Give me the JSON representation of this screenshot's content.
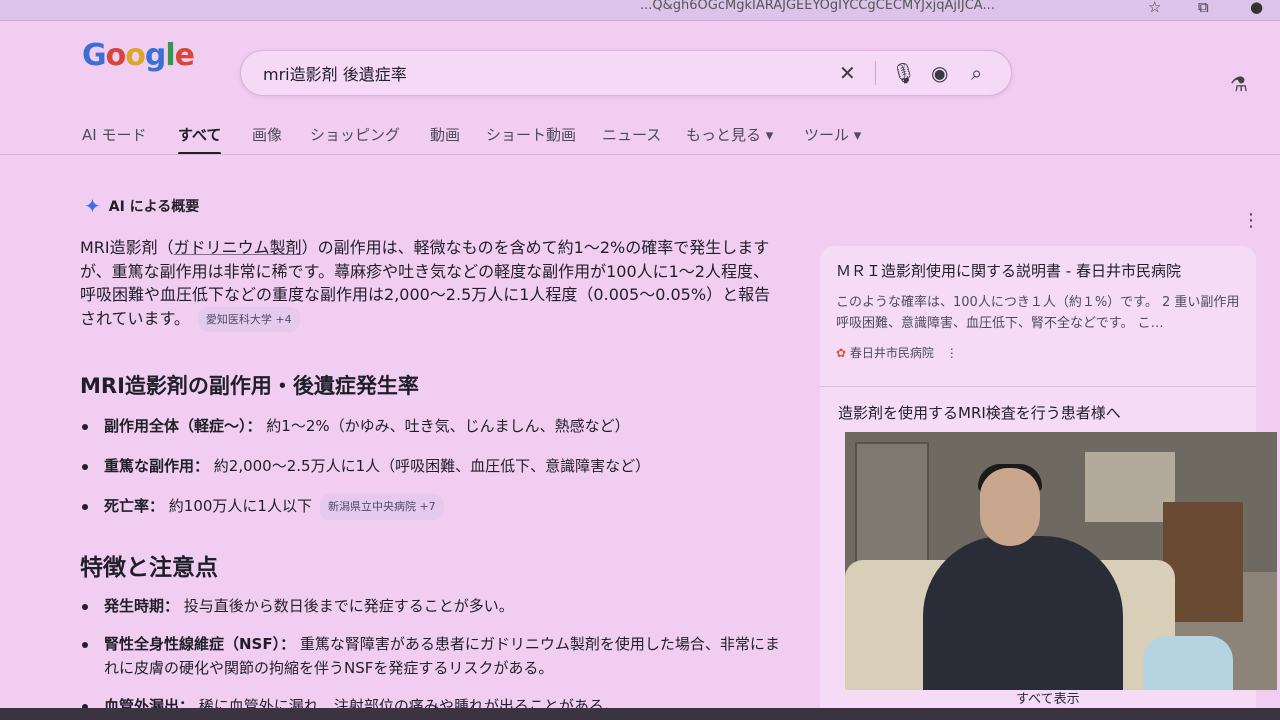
{
  "browser": {
    "url": "...Q&gh6OGcMgkIARAJGEEYOgIYCCgCECMYJxjqAjIJCA...",
    "icons": [
      "star-icon",
      "extensions-icon",
      "profile-icon"
    ]
  },
  "logo": {
    "letters": [
      "G",
      "o",
      "o",
      "g",
      "l",
      "e"
    ]
  },
  "search": {
    "value": "mri造影剤 後遺症率"
  },
  "tabs": [
    "AI モード",
    "すべて",
    "画像",
    "ショッピング",
    "動画",
    "ショート動画",
    "ニュース",
    "もっと見る ▾",
    "ツール ▾"
  ],
  "active_tab": "すべて",
  "overview": {
    "label": "AI による概要",
    "para_pre": "MRI造影剤（",
    "para_link": "ガドリニウム製剤",
    "para_post": "）の副作用は、軽微なものを含めて約1〜2%の確率で発生しますが、重篤な副作用は非常に稀です。蕁麻疹や吐き気などの軽度な副作用が100人に1〜2人程度、呼吸困難や血圧低下などの重度な副作用は2,000〜2.5万人に1人程度（0.005〜0.05%）と報告されています。",
    "para_chip": "愛知医科大学 +4"
  },
  "section1": {
    "heading": "MRI造影剤の副作用・後遺症発生率",
    "items": [
      {
        "label": "副作用全体（軽症〜）：",
        "text": " 約1〜2%（かゆみ、吐き気、じんましん、熱感など）"
      },
      {
        "label": "重篤な副作用：",
        "text": " 約2,000〜2.5万人に1人（呼吸困難、血圧低下、意識障害など）"
      },
      {
        "label": "死亡率：",
        "text": " 約100万人に1人以下",
        "chip": "新潟県立中央病院 +7"
      }
    ]
  },
  "section2": {
    "heading": "特徴と注意点",
    "items": [
      {
        "label": "発生時期：",
        "text": " 投与直後から数日後までに発症することが多い。"
      },
      {
        "label": "腎性全身性線維症（NSF）：",
        "text": " 重篤な腎障害がある患者にガドリニウム製剤を使用した場合、非常にまれに皮膚の硬化や関節の拘縮を伴うNSFを発症するリスクがある。"
      },
      {
        "label": "血管外漏出：",
        "text": " 稀に血管外に漏れ、注射部位の痛みや腫れが出ることがある。"
      }
    ]
  },
  "side": {
    "title": "ＭＲＩ造影剤使用に関する説明書 - 春日井市民病院",
    "snippet": "このような確率は、100人につき１人（約１%）です。 2 重い副作用 呼吸困難、意識障害、血圧低下、腎不全などです。 こ…",
    "source": "春日井市民病院",
    "title2": "造影剤を使用するMRI検査を行う患者様へ",
    "show_all": "すべて表示"
  }
}
